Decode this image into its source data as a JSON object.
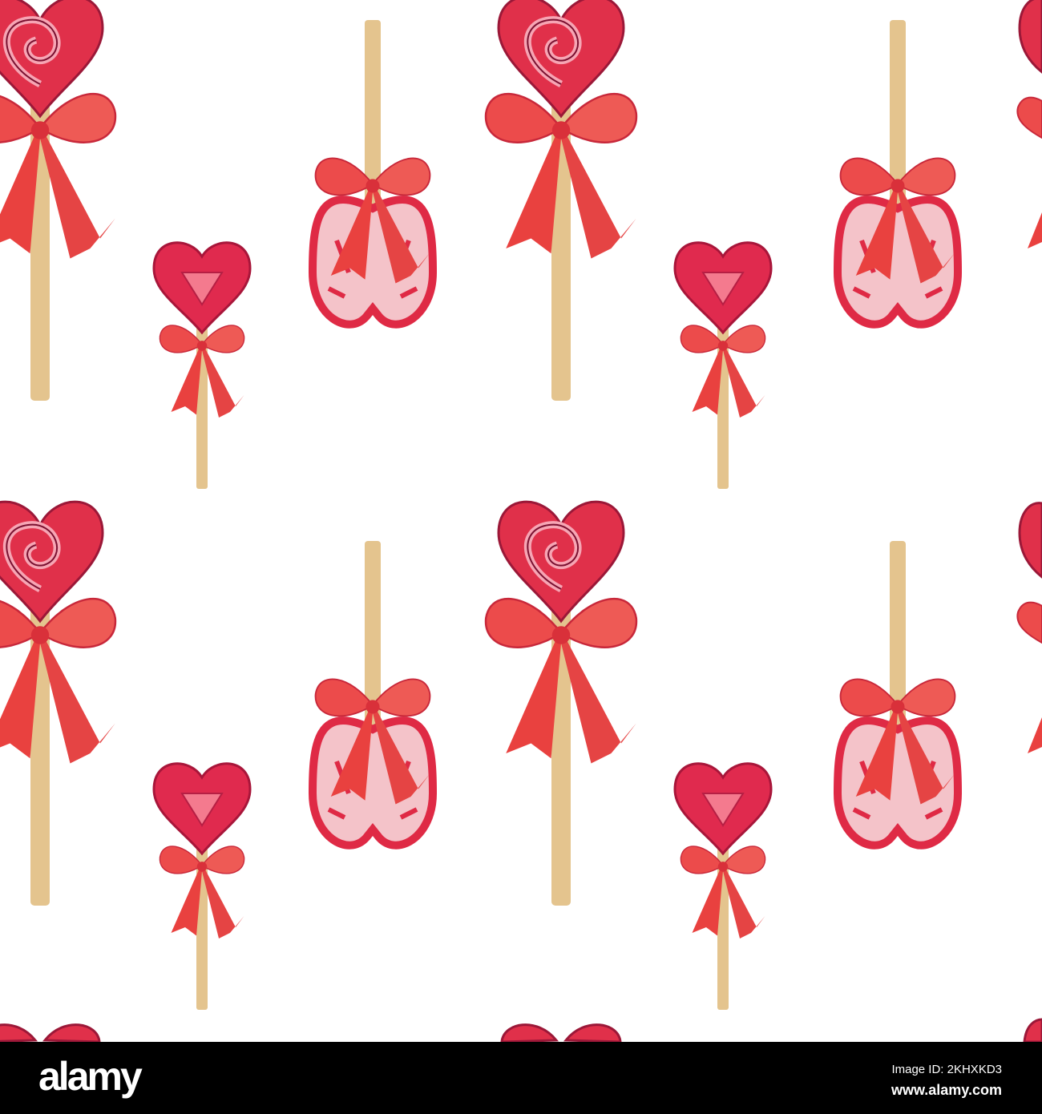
{
  "watermark": {
    "logo": "alamy",
    "image_id": "Image ID: 2KHXKD3",
    "url": "www.alamy.com"
  },
  "colors": {
    "background": "#ffffff",
    "candy_red": "#e0304a",
    "candy_pink": "#f6a5b4",
    "bow_red": "#ec4b4b",
    "stick": "#e4c48e",
    "footer": "#000000"
  }
}
